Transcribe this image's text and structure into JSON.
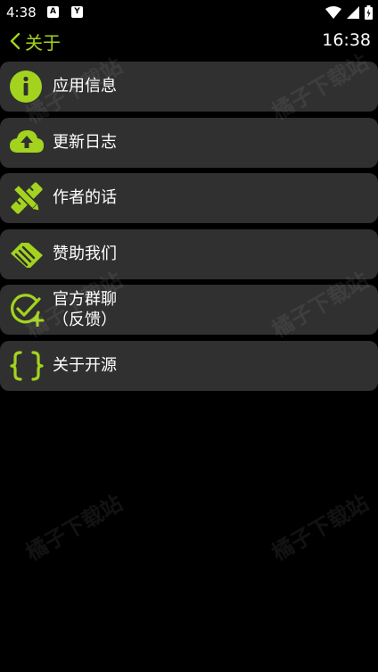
{
  "status_bar": {
    "time": "4:38",
    "app_icons": [
      "A",
      "Y"
    ]
  },
  "app_bar": {
    "title": "关于",
    "clock": "16:38"
  },
  "menu": {
    "items": [
      {
        "label": "应用信息",
        "icon": "info-icon"
      },
      {
        "label": "更新日志",
        "icon": "cloud-upload-icon"
      },
      {
        "label": "作者的话",
        "icon": "pencil-ruler-icon"
      },
      {
        "label": "赞助我们",
        "icon": "handshake-icon"
      },
      {
        "label": "官方群聊\n（反馈）",
        "icon": "check-plus-icon"
      },
      {
        "label": "关于开源",
        "icon": "braces-icon"
      }
    ]
  },
  "watermark": "橘子下载站",
  "colors": {
    "accent": "#a3d31f",
    "item_bg": "#303030",
    "background": "#000000"
  }
}
